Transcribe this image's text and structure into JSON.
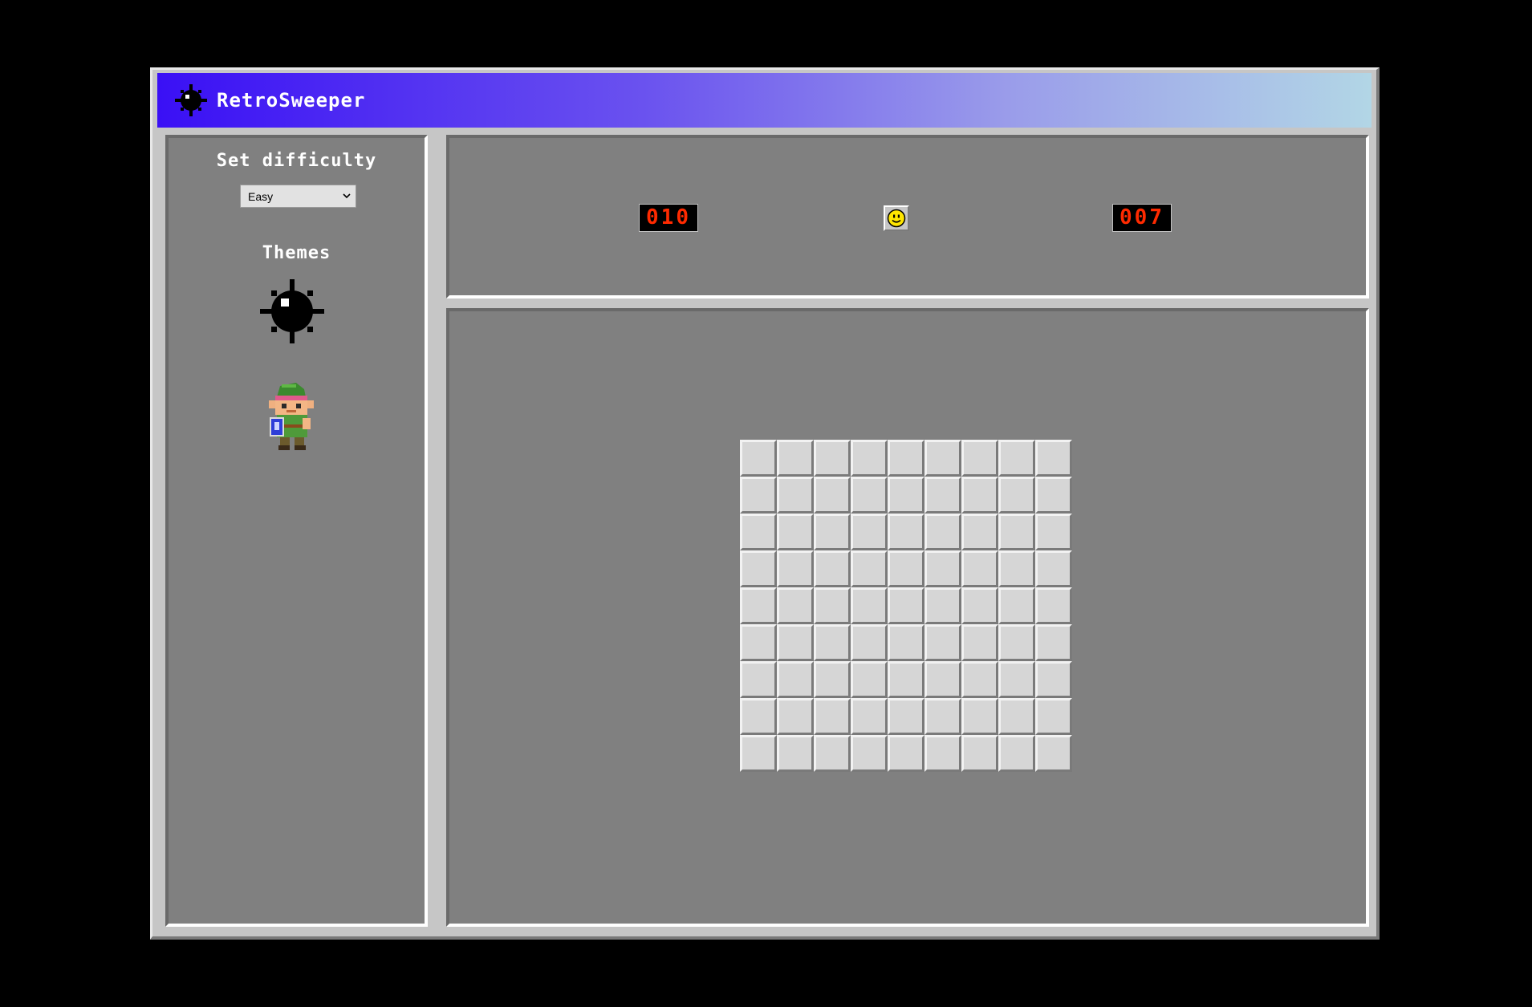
{
  "app": {
    "title": "RetroSweeper",
    "icon": "bomb-icon"
  },
  "sidebar": {
    "difficulty_heading": "Set difficulty",
    "difficulty_selected": "Easy",
    "themes_heading": "Themes",
    "themes": [
      {
        "name": "classic",
        "icon": "bomb-icon"
      },
      {
        "name": "zelda",
        "icon": "link-sprite-icon"
      }
    ]
  },
  "header": {
    "mine_counter": "010",
    "timer": "007",
    "face": "smiley-face-icon"
  },
  "board": {
    "rows": 9,
    "cols": 9,
    "state": "all-covered"
  },
  "colors": {
    "title_gradient_start": "#3a10f5",
    "title_gradient_end": "#b2d6e6",
    "panel_bg": "#808080",
    "cell_bg": "#d6d6d6",
    "counter_digits": "#ff2a00"
  }
}
